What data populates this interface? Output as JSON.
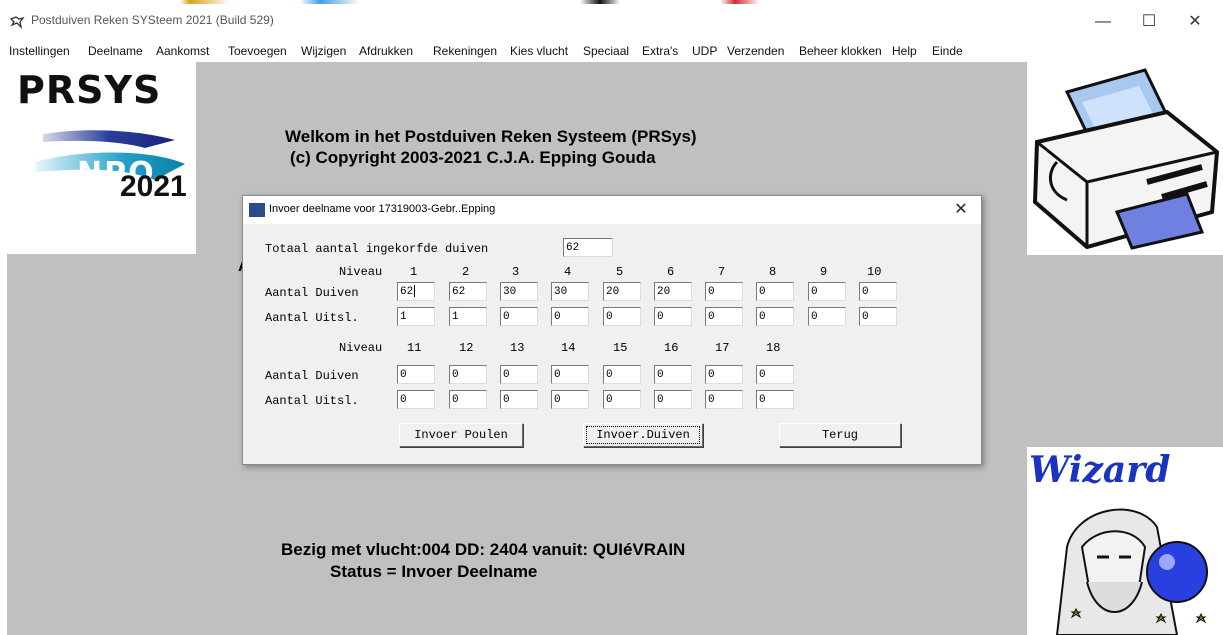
{
  "window": {
    "title": "Postduiven Reken SYSteem 2021 (Build 529)",
    "minimize": "—",
    "maximize": "☐",
    "close": "✕"
  },
  "menu": [
    "Instellingen",
    "Deelname",
    "Aankomst",
    "Toevoegen",
    "Wijzigen",
    "Afdrukken",
    "Rekeningen",
    "Kies vlucht",
    "Speciaal",
    "Extra's",
    "UDP",
    "Verzenden",
    "Beheer klokken",
    "Help",
    "Einde"
  ],
  "logos": {
    "prsys": "PRSYS",
    "npo": "NPO",
    "year": "2021",
    "wizard": "Wizard"
  },
  "main": {
    "welcome": "Welkom in het Postduiven Reken Systeem (PRSys)",
    "copyright": "(c) Copyright 2003-2021 C.J.A. Epping Gouda",
    "partial_letter": "A",
    "busy": "Bezig met vlucht:004 DD: 2404 vanuit: QUIéVRAIN",
    "status": "Status = Invoer Deelname"
  },
  "dialog": {
    "title": "Invoer deelname voor 17319003-Gebr..Epping",
    "close": "✕",
    "total_label": "Totaal aantal ingekorfde duiven",
    "total_value": "62",
    "niveau_label": "Niveau",
    "duiven_label": "Aantal Duiven",
    "uitsl_label": "Aantal Uitsl.",
    "row1": {
      "levels": [
        "1",
        "2",
        "3",
        "4",
        "5",
        "6",
        "7",
        "8",
        "9",
        "10"
      ],
      "duiven": [
        "62",
        "62",
        "30",
        "30",
        "20",
        "20",
        "0",
        "0",
        "0",
        "0"
      ],
      "uitsl": [
        "1",
        "1",
        "0",
        "0",
        "0",
        "0",
        "0",
        "0",
        "0",
        "0"
      ]
    },
    "row2": {
      "levels": [
        "11",
        "12",
        "13",
        "14",
        "15",
        "16",
        "17",
        "18"
      ],
      "duiven": [
        "0",
        "0",
        "0",
        "0",
        "0",
        "0",
        "0",
        "0"
      ],
      "uitsl": [
        "0",
        "0",
        "0",
        "0",
        "0",
        "0",
        "0",
        "0"
      ]
    },
    "buttons": {
      "poulen": "Invoer Poulen",
      "duiven": "Invoer.Duiven",
      "terug": "Terug"
    }
  },
  "icons": {
    "app": "pigeon-icon",
    "printer": "printer-illustration",
    "wizard": "wizard-illustration"
  }
}
